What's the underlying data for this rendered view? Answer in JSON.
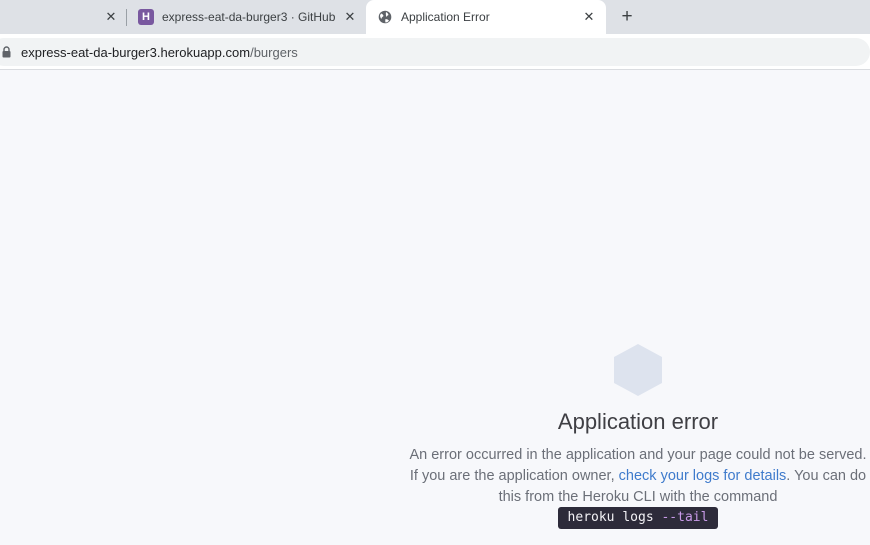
{
  "tabs": [
    {
      "title": "",
      "close": "✕"
    },
    {
      "title": "express-eat-da-burger3 · GitHub",
      "favicon": "H",
      "close": "✕"
    },
    {
      "title": "Application Error",
      "close": "✕",
      "active": true
    }
  ],
  "new_tab": "+",
  "address": {
    "host": "express-eat-da-burger3.herokuapp.com",
    "path": "/burgers"
  },
  "error": {
    "heading": "Application error",
    "line1": "An error occurred in the application and your page could not be served. If you are the application owner, ",
    "link": "check your logs for details",
    "line2": ". You can do this from the Heroku CLI with the command",
    "command": "heroku logs",
    "command_flag": "--tail"
  },
  "colors": {
    "heroku_purple": "#79589f",
    "link": "#3f7bcc",
    "hex_icon": "#dde3ee",
    "code_bg": "#2d2b3a"
  }
}
